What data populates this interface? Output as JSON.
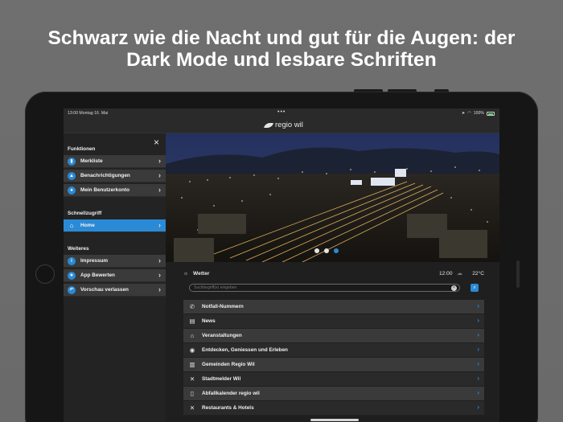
{
  "headline": {
    "line1": "Schwarz wie die Nacht und gut für die Augen: der",
    "line2": "Dark Mode und lesbare Schriften"
  },
  "status_bar": {
    "time_date": "13:00  Montag 16. Mai",
    "dots": "•••",
    "battery_text": "100%"
  },
  "navbar": {
    "logo_text": "regio wil"
  },
  "sidebar": {
    "close_icon": "×",
    "sections": [
      {
        "title": "Funktionen",
        "items": [
          {
            "label": "Merkliste",
            "icon": "bookmark-icon",
            "glyph": "▮"
          },
          {
            "label": "Benachrichtigungen",
            "icon": "bell-icon",
            "glyph": "▲"
          },
          {
            "label": "Mein Benutzerkonto",
            "icon": "user-icon",
            "glyph": "●"
          }
        ]
      },
      {
        "title": "Schnellzugriff",
        "items": [
          {
            "label": "Home",
            "icon": "home-icon",
            "glyph": "⌂",
            "active": true
          }
        ]
      },
      {
        "title": "Weiteres",
        "items": [
          {
            "label": "Impressum",
            "icon": "info-icon",
            "glyph": "i"
          },
          {
            "label": "App Bewerten",
            "icon": "star-icon",
            "glyph": "★"
          },
          {
            "label": "Vorschau verlassen",
            "icon": "exit-icon",
            "glyph": "↶"
          }
        ]
      }
    ]
  },
  "weather": {
    "label": "Wetter",
    "time": "12:00",
    "temperature": "22°C"
  },
  "search": {
    "placeholder": "Suchbegriff(e) eingeben"
  },
  "list_items": [
    {
      "label": "Notfall-Nummern",
      "icon": "phone-icon",
      "glyph": "✆"
    },
    {
      "label": "News",
      "icon": "news-icon",
      "glyph": "▤"
    },
    {
      "label": "Veranstaltungen",
      "icon": "building-icon",
      "glyph": "⌂"
    },
    {
      "label": "Entdecken, Geniessen und Erleben",
      "icon": "compass-icon",
      "glyph": "◉"
    },
    {
      "label": "Gemeinden Regio Wil",
      "icon": "city-icon",
      "glyph": "▥"
    },
    {
      "label": "Stadtmelder Wil",
      "icon": "tools-icon",
      "glyph": "✕"
    },
    {
      "label": "Abfallkalender regio wil",
      "icon": "trash-icon",
      "glyph": "▯"
    },
    {
      "label": "Restaurants & Hotels",
      "icon": "cutlery-icon",
      "glyph": "✕"
    }
  ],
  "colors": {
    "accent": "#2a8ad6",
    "row_dark": "#3a3a3a",
    "background": "#1f1f1f"
  }
}
